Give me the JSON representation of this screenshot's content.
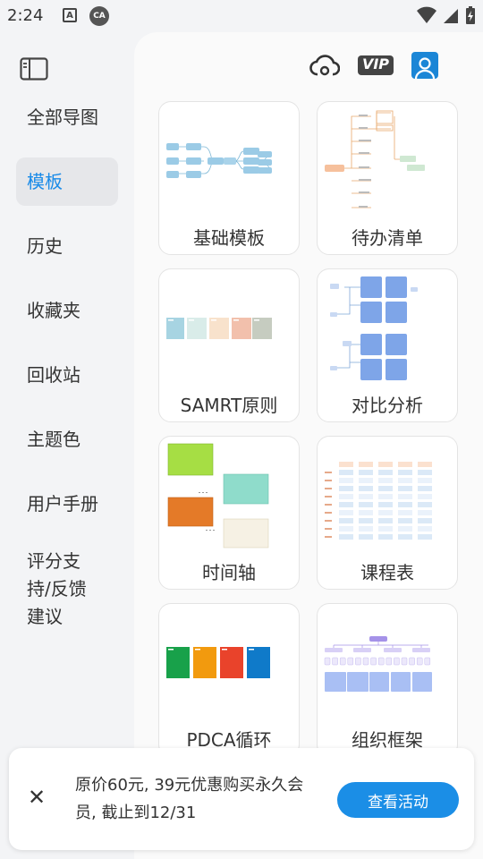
{
  "status_bar": {
    "time": "2:24",
    "a_icon": "A",
    "ca_icon": "CA"
  },
  "sidebar": {
    "items": [
      {
        "label": "全部导图"
      },
      {
        "label": "模板",
        "active": true
      },
      {
        "label": "历史"
      },
      {
        "label": "收藏夹"
      },
      {
        "label": "回收站"
      },
      {
        "label": "主题色"
      },
      {
        "label": "用户手册"
      },
      {
        "label": "评分支持/反馈建议"
      }
    ]
  },
  "header": {
    "vip_label": "VIP",
    "icons": [
      "cloud-sync-icon",
      "vip-icon",
      "user-icon"
    ]
  },
  "templates": [
    {
      "label": "基础模板"
    },
    {
      "label": "待办清单"
    },
    {
      "label": "SAMRT原则"
    },
    {
      "label": "对比分析"
    },
    {
      "label": "时间轴"
    },
    {
      "label": "课程表"
    },
    {
      "label": "PDCA循环"
    },
    {
      "label": "组织框架"
    }
  ],
  "promo": {
    "text": "原价60元, 39元优惠购买永久会员, 截止到12/31",
    "button_label": "查看活动",
    "accent": "#1b8ee6"
  }
}
